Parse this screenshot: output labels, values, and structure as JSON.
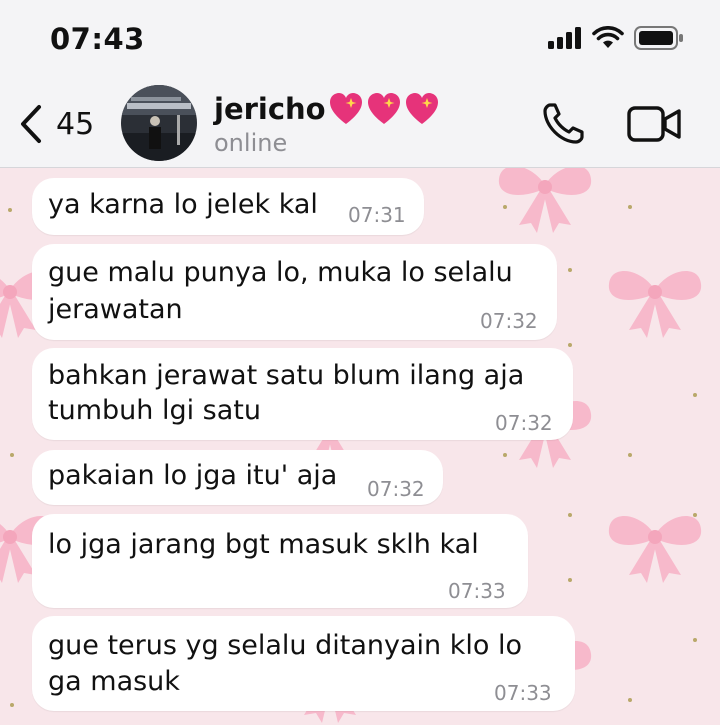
{
  "status_bar": {
    "time": "07:43",
    "signal_icon": "cellular-signal-icon",
    "wifi_icon": "wifi-icon",
    "battery_icon": "battery-icon"
  },
  "header": {
    "back_icon": "chevron-left-icon",
    "unread_count": "45",
    "contact_name": "jericho",
    "name_emojis": [
      "sparkling-heart-icon",
      "sparkling-heart-icon",
      "sparkling-heart-icon"
    ],
    "contact_status": "online",
    "call_icon": "phone-icon",
    "video_icon": "video-camera-icon"
  },
  "colors": {
    "header_bg": "#f4f4f6",
    "wallpaper_bg": "#f8e6ea",
    "bow_pink": "#f7b9cb",
    "bubble_bg": "#ffffff",
    "timestamp": "#8e8e93",
    "status_gray": "#8e8e93"
  },
  "messages": [
    {
      "lines": [
        "ya karna lo jelek kal"
      ],
      "time": "07:31"
    },
    {
      "lines": [
        "gue malu punya lo, muka lo selalu",
        "jerawatan"
      ],
      "time": "07:32"
    },
    {
      "lines": [
        "bahkan jerawat satu blum ilang aja",
        "tumbuh lgi satu"
      ],
      "time": "07:32"
    },
    {
      "lines": [
        "pakaian lo jga itu' aja"
      ],
      "time": "07:32"
    },
    {
      "lines": [
        "lo jga jarang bgt masuk sklh kal"
      ],
      "time": "07:33"
    },
    {
      "lines": [
        "gue terus yg selalu ditanyain klo lo",
        "ga masuk"
      ],
      "time": "07:33"
    }
  ]
}
